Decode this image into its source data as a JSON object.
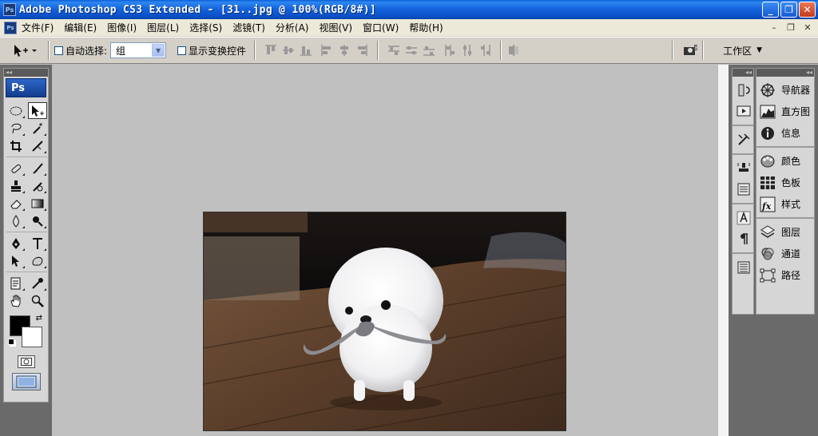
{
  "window": {
    "app_icon": "Ps",
    "title": "Adobe Photoshop CS3 Extended - [31..jpg @ 100%(RGB/8#)]",
    "buttons": {
      "minimize": "_",
      "maximize": "❐",
      "close": "✕"
    }
  },
  "menubar": {
    "doc_icon": "Ps",
    "items": [
      "文件(F)",
      "编辑(E)",
      "图像(I)",
      "图层(L)",
      "选择(S)",
      "滤镜(T)",
      "分析(A)",
      "视图(V)",
      "窗口(W)",
      "帮助(H)"
    ],
    "doc_buttons": {
      "minimize": "–",
      "restore": "❐",
      "close": "✕"
    }
  },
  "options": {
    "auto_select_label": "自动选择:",
    "auto_select_value": "组",
    "show_transform_label": "显示变换控件",
    "workspace_label": "工作区"
  },
  "toolbox": {
    "logo": "Ps",
    "tools": [
      "marquee-tool",
      "move-tool",
      "lasso-tool",
      "magic-wand-tool",
      "crop-tool",
      "slice-tool",
      "healing-brush-tool",
      "brush-tool",
      "clone-stamp-tool",
      "history-brush-tool",
      "eraser-tool",
      "gradient-tool",
      "blur-tool",
      "dodge-tool",
      "pen-tool",
      "type-tool",
      "path-selection-tool",
      "custom-shape-tool",
      "notes-tool",
      "eyedropper-tool",
      "hand-tool",
      "zoom-tool"
    ],
    "foreground_color": "#000000",
    "background_color": "#ffffff"
  },
  "panels": {
    "group1": [
      "导航器",
      "直方图",
      "信息"
    ],
    "group2": [
      "颜色",
      "色板",
      "样式"
    ],
    "group3": [
      "图层",
      "通道",
      "路径"
    ]
  },
  "colors": {
    "title_bar": "#1261dc",
    "chrome": "#d4d0c8",
    "workspace_bg": "#c0c0c0",
    "dock_bg": "#6a6a6a"
  }
}
